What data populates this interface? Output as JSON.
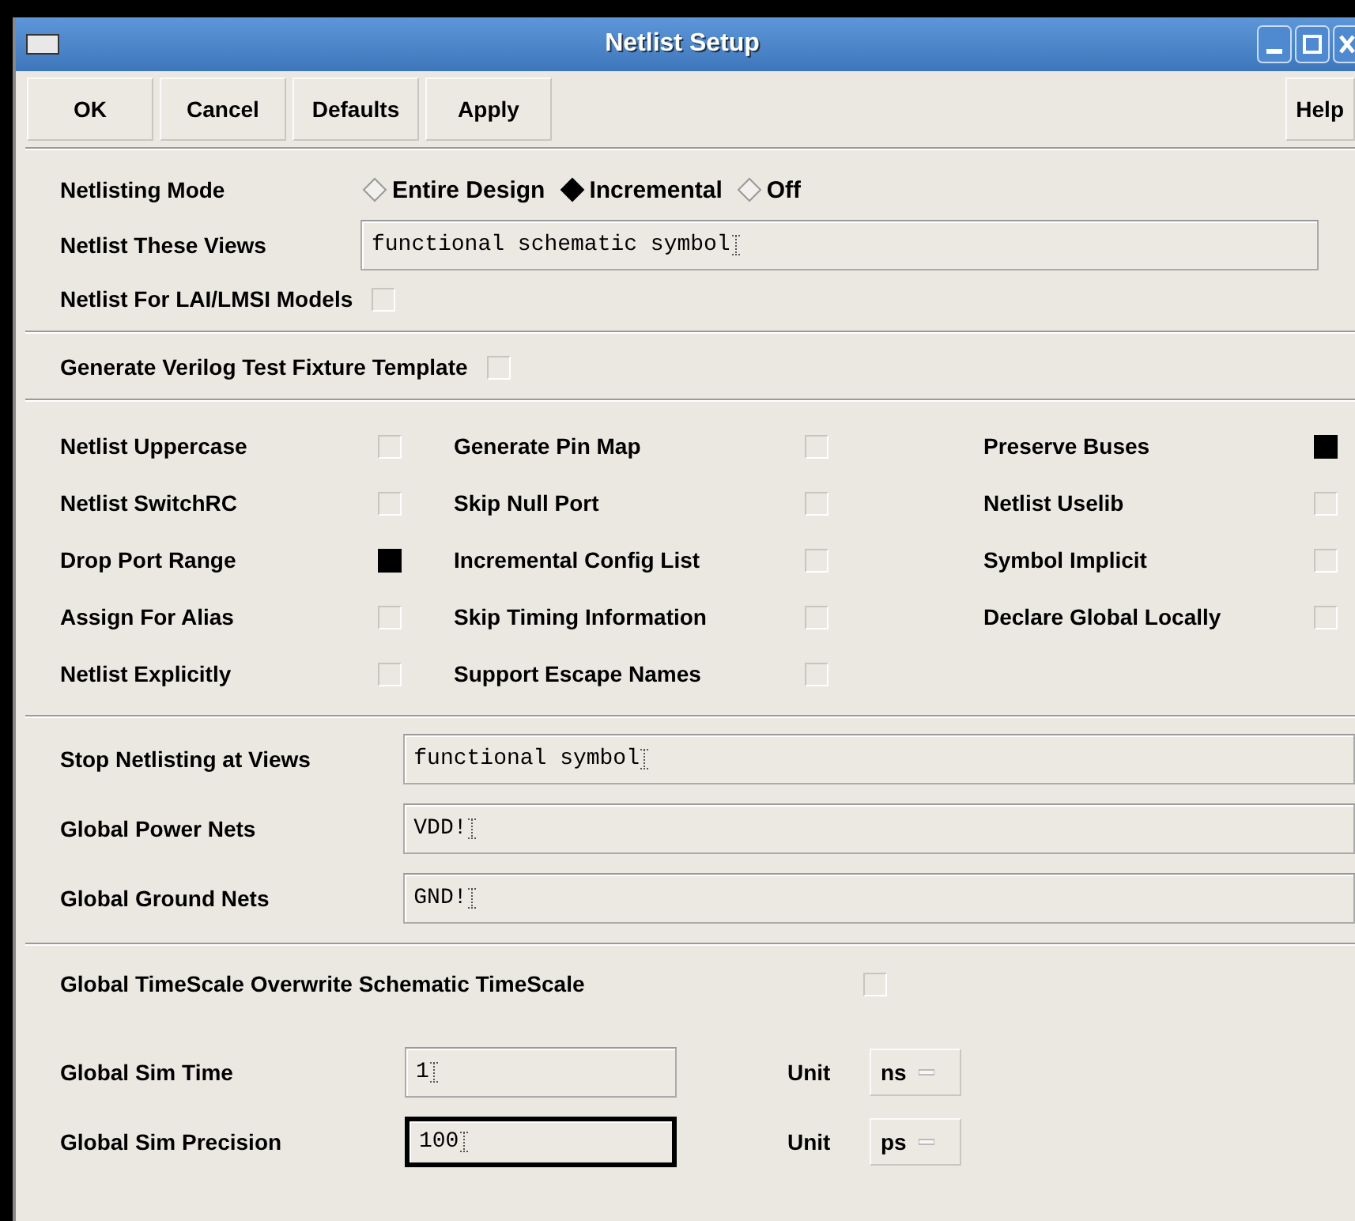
{
  "window": {
    "title": "Netlist Setup"
  },
  "buttons": [
    {
      "label": "OK"
    },
    {
      "label": "Cancel"
    },
    {
      "label": "Defaults"
    },
    {
      "label": "Apply"
    }
  ],
  "help_button": {
    "label": "Help"
  },
  "netlisting_mode": {
    "label": "Netlisting Mode",
    "options": [
      {
        "label": "Entire Design",
        "selected": false
      },
      {
        "label": "Incremental",
        "selected": true
      },
      {
        "label": "Off",
        "selected": false
      }
    ]
  },
  "netlist_these_views": {
    "label": "Netlist These Views",
    "value": "functional schematic symbol"
  },
  "lai_lmsi_models": {
    "label": "Netlist For LAI/LMSI Models",
    "checked": false
  },
  "test_fixture": {
    "label": "Generate Verilog Test Fixture Template",
    "checked": false
  },
  "option_columns": [
    {
      "items": [
        {
          "label": "Netlist Uppercase",
          "checked": false
        },
        {
          "label": "Netlist SwitchRC",
          "checked": false
        },
        {
          "label": "Drop Port Range",
          "checked": true
        },
        {
          "label": "Assign For Alias",
          "checked": false
        },
        {
          "label": "Netlist Explicitly",
          "checked": false
        }
      ]
    },
    {
      "items": [
        {
          "label": "Generate Pin Map",
          "checked": false
        },
        {
          "label": "Skip Null Port",
          "checked": false
        },
        {
          "label": "Incremental Config List",
          "checked": false
        },
        {
          "label": "Skip Timing Information",
          "checked": false
        },
        {
          "label": "Support Escape Names",
          "checked": false
        }
      ]
    },
    {
      "items": [
        {
          "label": "Preserve Buses",
          "checked": true
        },
        {
          "label": "Netlist Uselib",
          "checked": false
        },
        {
          "label": "Symbol Implicit",
          "checked": false
        },
        {
          "label": "Declare Global Locally",
          "checked": false
        }
      ]
    }
  ],
  "net_fields": [
    {
      "label": "Stop Netlisting at Views",
      "value": "functional symbol"
    },
    {
      "label": "Global Power Nets",
      "value": "VDD!"
    },
    {
      "label": "Global Ground Nets",
      "value": "GND!"
    }
  ],
  "timescale_overwrite": {
    "label": "Global TimeScale Overwrite Schematic TimeScale",
    "checked": false
  },
  "sim_fields": [
    {
      "label": "Global Sim Time",
      "value": "1",
      "focused": false,
      "unit_label": "Unit",
      "unit": "ns"
    },
    {
      "label": "Global Sim Precision",
      "value": "100",
      "focused": true,
      "unit_label": "Unit",
      "unit": "ps"
    }
  ]
}
